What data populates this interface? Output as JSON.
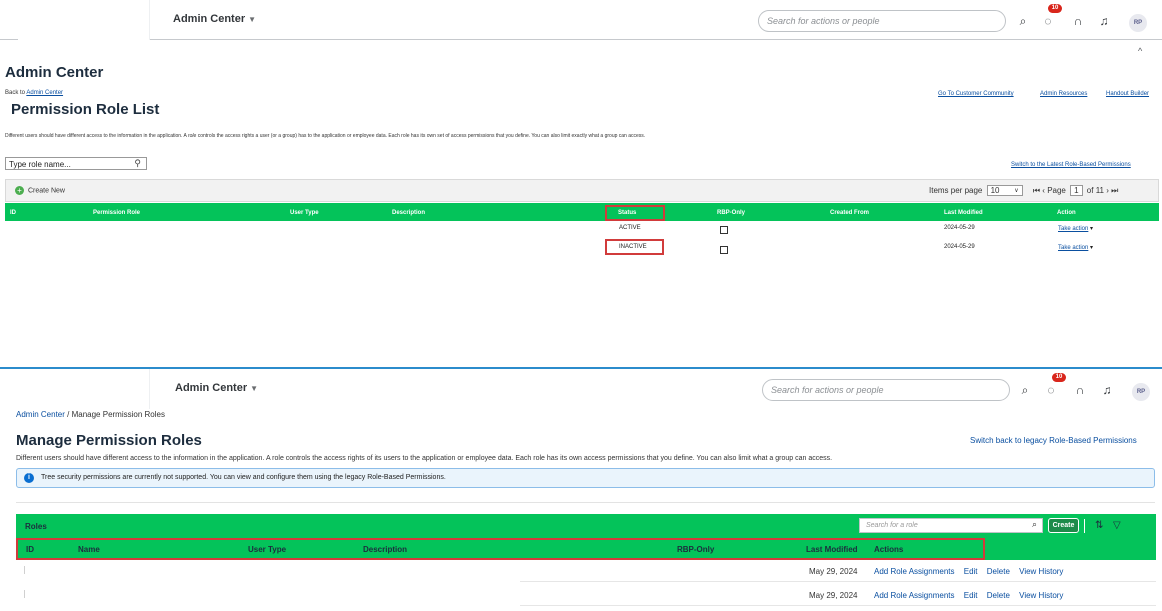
{
  "shell": {
    "app_title": "Admin Center",
    "search_placeholder": "Search for actions or people",
    "notification_count": "10",
    "avatar_initials": "RP"
  },
  "legacy": {
    "title": "Admin Center",
    "back_prefix": "Back to ",
    "back_link": "Admin Center",
    "subtitle": "Permission Role List",
    "links": [
      "Go To Customer Community",
      "Admin Resources",
      "Handout Builder"
    ],
    "description_pre": "Different users should have different access to the information in the application. A ",
    "description_em": "role",
    "description_post": " controls the access rights a user (or a group) has to the application or employee data. Each role has its own set of access permissions that you define. You can also limit exactly what a group can access.",
    "role_input_value": "Type role name...",
    "switch_link": "Switch to the Latest Role-Based Permissions",
    "create_label": "Create New",
    "pager": {
      "items_label": "Items per page",
      "items_value": "10",
      "page_label": "Page",
      "page_value": "1",
      "of_label": "of 11"
    },
    "columns": [
      "ID",
      "Permission Role",
      "User Type",
      "Description",
      "Status",
      "RBP-Only",
      "Created From",
      "Last Modified",
      "Action"
    ],
    "rows": [
      {
        "status": "ACTIVE",
        "last_modified": "2024-05-29",
        "action": "Take action"
      },
      {
        "status": "INACTIVE",
        "last_modified": "2024-05-29",
        "action": "Take action"
      }
    ]
  },
  "modern": {
    "breadcrumb_link": "Admin Center",
    "breadcrumb_sep": " / ",
    "breadcrumb_current": "Manage Permission Roles",
    "title": "Manage Permission Roles",
    "switch_link": "Switch back to legacy Role-Based Permissions",
    "description": "Different users should have different access to the information in the application. A role controls the access rights of its users to the application or employee data. Each role has its own access permissions that you define. You can also limit what a group can access.",
    "info_message": "Tree security permissions are currently not supported. You can view and configure them using the legacy Role-Based Permissions.",
    "table_title": "Roles",
    "role_search_placeholder": "Search for a role",
    "create_label": "Create",
    "columns": [
      "ID",
      "Name",
      "User Type",
      "Description",
      "RBP-Only",
      "Last Modified",
      "Actions"
    ],
    "rows": [
      {
        "last_modified": "May 29, 2024",
        "actions": [
          "Add Role Assignments",
          "Edit",
          "Delete",
          "View History"
        ]
      },
      {
        "last_modified": "May 29, 2024",
        "actions": [
          "Add Role Assignments",
          "Edit",
          "Delete",
          "View History"
        ]
      }
    ]
  },
  "colors": {
    "table_header_green": "#04c35a",
    "highlight_red": "#d13b3b",
    "link_blue": "#0a4fa0",
    "info_blue": "#0a6ed1"
  }
}
